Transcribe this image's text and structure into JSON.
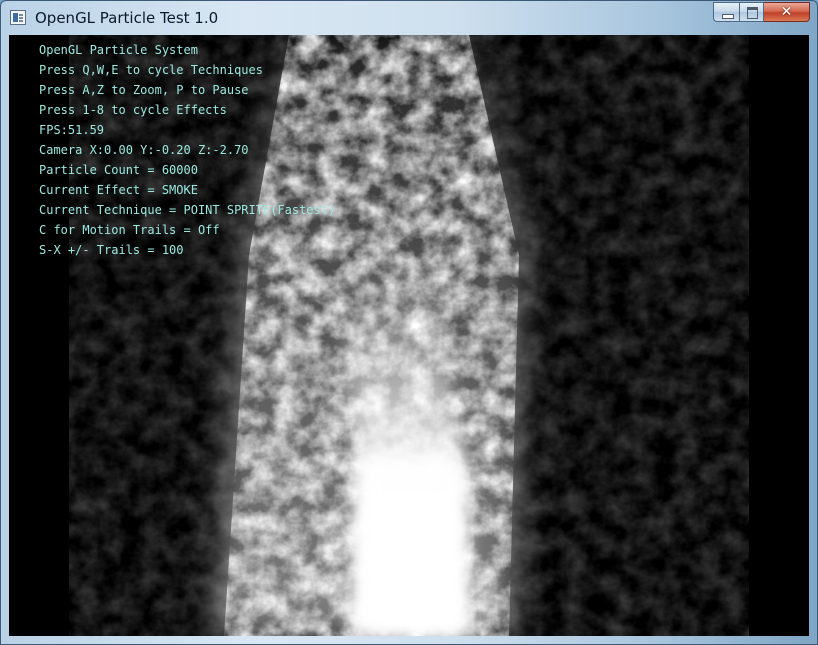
{
  "window": {
    "title": "OpenGL Particle Test 1.0",
    "icon": "app-window-icon",
    "controls": {
      "minimize": "minimize-icon",
      "maximize": "maximize-icon",
      "close_label": "✕"
    }
  },
  "hud": {
    "lines": [
      "OpenGL Particle System",
      "Press Q,W,E to cycle Techniques",
      "Press A,Z to Zoom, P to Pause",
      "Press 1-8 to cycle Effects",
      "FPS:51.59",
      "Camera X:0.00 Y:-0.20 Z:-2.70",
      "Particle Count = 60000",
      "Current Effect = SMOKE",
      "Current Technique = POINT SPRITE(Fastest)",
      "C for Motion Trails = Off",
      "S-X +/- Trails = 100"
    ],
    "color": "#9be9e0"
  },
  "scene": {
    "effect": "smoke",
    "background": "#000000",
    "smoke_color": "#ffffff"
  }
}
